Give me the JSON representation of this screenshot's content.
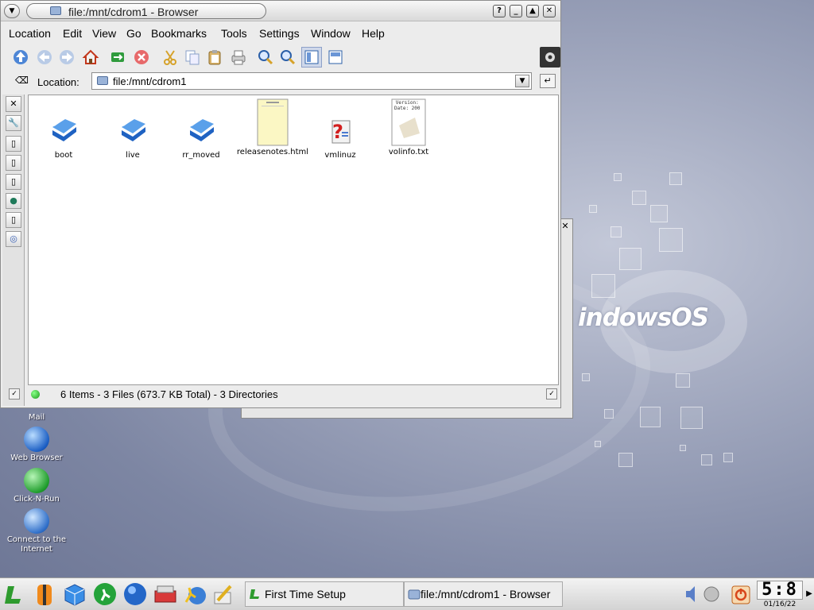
{
  "window": {
    "title": "file:/mnt/cdrom1 - Browser",
    "menu": [
      "Location",
      "Edit",
      "View",
      "Go",
      "Bookmarks",
      "Tools",
      "Settings",
      "Window",
      "Help"
    ],
    "location_label": "Location:",
    "location_value": "file:/mnt/cdrom1",
    "files": [
      {
        "name": "boot",
        "type": "folder"
      },
      {
        "name": "live",
        "type": "folder"
      },
      {
        "name": "rr_moved",
        "type": "folder"
      },
      {
        "name": "releasenotes.html",
        "type": "html"
      },
      {
        "name": "vmlinuz",
        "type": "unknown"
      },
      {
        "name": "volinfo.txt",
        "type": "text",
        "preview": "Version:\nDate: 200"
      }
    ],
    "status_text": "6 Items - 3 Files (673.7 KB Total) - 3 Directories"
  },
  "desktop": {
    "brand": "indowsOS",
    "icons": [
      {
        "label": "Mail"
      },
      {
        "label": "Web Browser"
      },
      {
        "label": "Click-N-Run"
      },
      {
        "label": "Connect to the Internet"
      }
    ]
  },
  "taskbar": {
    "tasks": [
      {
        "label": "First Time Setup"
      },
      {
        "label": "file:/mnt/cdrom1 - Browser"
      }
    ],
    "clock_time": "5:8",
    "clock_date": "01/16/22"
  },
  "colors": {
    "desktop_bg": "#8a92ad",
    "folder_blue": "#3b82d6",
    "status_led": "#1a9a1a"
  }
}
